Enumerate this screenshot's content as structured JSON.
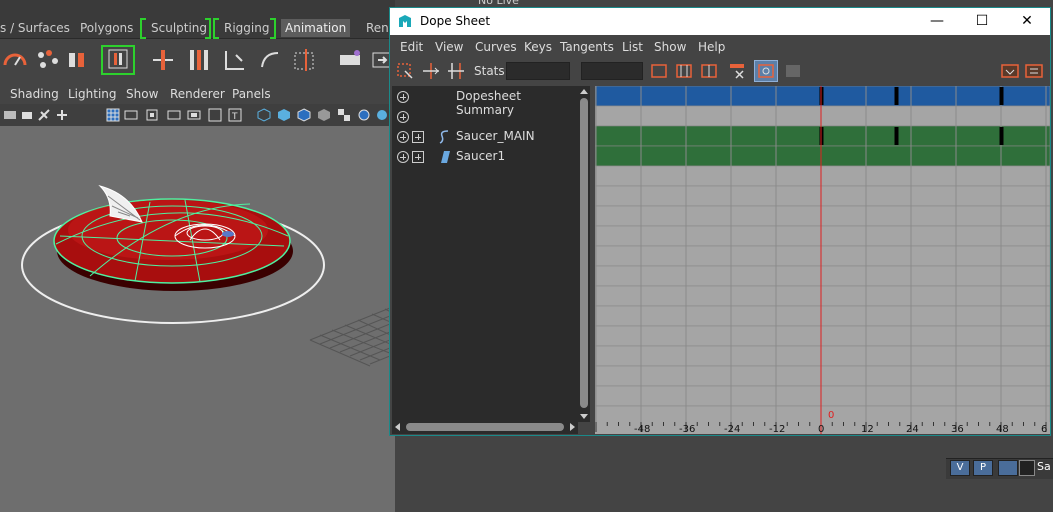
{
  "background": {
    "top_partial_label": "No Live Surface",
    "shelf_tabs": [
      {
        "label": "s / Surfaces",
        "active": false
      },
      {
        "label": "Polygons",
        "active": false
      },
      {
        "label": "Sculpting",
        "active": false
      },
      {
        "label": "Rigging",
        "active": false
      },
      {
        "label": "Animation",
        "active": true
      },
      {
        "label": "Rend",
        "active": false
      }
    ],
    "panel_menu": [
      "Shading",
      "Lighting",
      "Show",
      "Renderer",
      "Panels"
    ],
    "bottom_right": {
      "v_label": "V",
      "p_label": "P",
      "partial_label": "Sa"
    }
  },
  "window": {
    "title": "Dope Sheet",
    "minimize_glyph": "—",
    "maximize_glyph": "☐",
    "close_glyph": "✕"
  },
  "menu": [
    "Edit",
    "View",
    "Curves",
    "Keys",
    "Tangents",
    "List",
    "Show",
    "Help"
  ],
  "toolbar": {
    "stats_label": "Stats",
    "stats_value": "",
    "stats_value_2": ""
  },
  "outliner": {
    "summary_label": "Dopesheet Summary",
    "items": [
      {
        "label": "Saucer_MAIN",
        "icon": "curve-icon"
      },
      {
        "label": "Saucer1",
        "icon": "mesh-icon"
      }
    ]
  },
  "graph": {
    "current_frame": "0",
    "ruler_labels": [
      "-48",
      "-36",
      "-24",
      "-12",
      "0",
      "12",
      "24",
      "36",
      "48",
      "6"
    ],
    "keyframes_at": [
      0,
      20,
      48
    ],
    "colors": {
      "summary": "#1f5aa0",
      "object": "#2f6f3a",
      "empty": "#a5a5a5",
      "current_time": "#e02020"
    }
  }
}
